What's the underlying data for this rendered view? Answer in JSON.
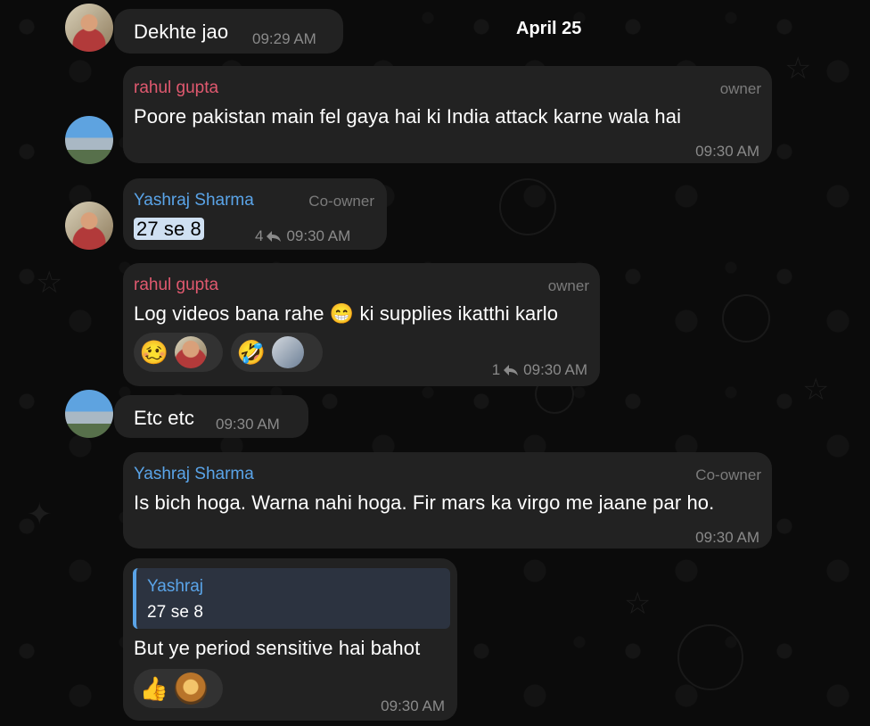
{
  "date_label": "April 25",
  "messages": [
    {
      "text": "Dekhte jao",
      "time": "09:29 AM"
    },
    {
      "sender": "rahul gupta",
      "role": "owner",
      "text": "Poore pakistan main fel gaya hai ki India attack karne wala hai",
      "time": "09:30 AM"
    },
    {
      "sender": "Yashraj Sharma",
      "role": "Co-owner",
      "text": "27 se 8",
      "reply_count": "4",
      "time": "09:30 AM"
    },
    {
      "sender": "rahul gupta",
      "role": "owner",
      "text": "Log videos bana rahe 😁 ki supplies ikatthi karlo",
      "reply_count": "1",
      "time": "09:30 AM",
      "reactions": [
        {
          "emoji": "🥴",
          "label": "woozy-face"
        },
        {
          "emoji": "🤣",
          "label": "rolling-laughing-face"
        }
      ]
    },
    {
      "text": "Etc etc",
      "time": "09:30 AM"
    },
    {
      "sender": "Yashraj Sharma",
      "role": "Co-owner",
      "text": "Is bich hoga. Warna nahi hoga. Fir mars ka virgo me jaane par ho.",
      "time": "09:30 AM"
    },
    {
      "reply_to": {
        "sender": "Yashraj",
        "text": "27 se 8"
      },
      "text": "But ye period sensitive hai bahot",
      "time": "09:30 AM",
      "reactions": [
        {
          "emoji": "👍",
          "label": "thumbs-up"
        }
      ]
    }
  ],
  "colors": {
    "rahul": "#e0596f",
    "yashraj": "#5aa4e8",
    "bubble": "#222222",
    "background": "#0b0b0b"
  }
}
